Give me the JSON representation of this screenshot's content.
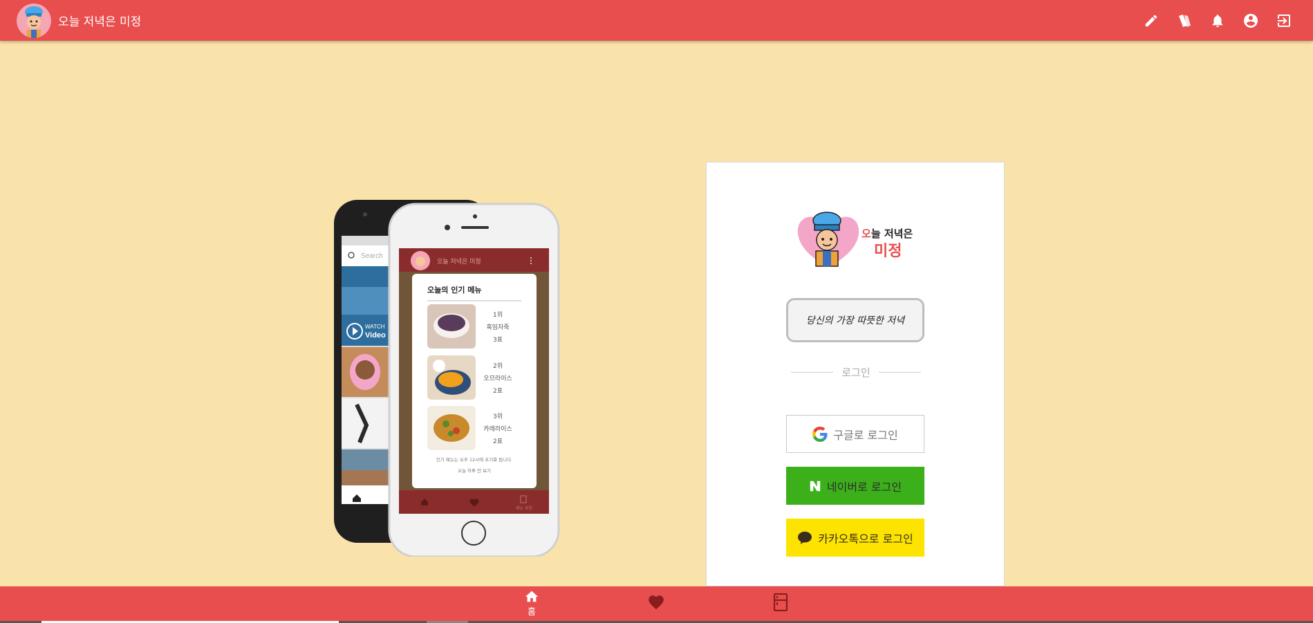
{
  "header": {
    "title": "오늘 저녁은 미정",
    "actions": [
      {
        "icon": "pencil-icon"
      },
      {
        "icon": "cards-icon"
      },
      {
        "icon": "bell-icon"
      },
      {
        "icon": "account-circle-icon"
      },
      {
        "icon": "logout-icon"
      }
    ]
  },
  "phone_mock": {
    "left_phone": {
      "search_placeholder": "Search",
      "video_caption_small": "WATCH",
      "video_caption": "Video"
    },
    "right_phone": {
      "app_title": "오늘 저녁은 미정",
      "popular_title": "오늘의 인기 메뉴",
      "items": [
        {
          "rank": "1위",
          "name": "흑임자죽",
          "votes": "3표"
        },
        {
          "rank": "2위",
          "name": "오므라이스",
          "votes": "2표"
        },
        {
          "rank": "3위",
          "name": "카레라이스",
          "votes": "2표"
        }
      ],
      "note1": "인기 메뉴는 오후 12시에 초기화 됩니다.",
      "note2": "오늘 하루 안 보기",
      "nav_last_label": "메뉴 추천"
    }
  },
  "login": {
    "brand_accent": "오",
    "brand_rest": "늘 저녁은",
    "brand_main": "미정",
    "slogan": "당신의 가장 따뜻한 저녁",
    "divider_label": "로그인",
    "google_label": "구글로 로그인",
    "naver_label": "네이버로 로그인",
    "kakao_label": "카카오톡으로 로그인"
  },
  "bottom_nav": {
    "home_label": "홈",
    "items": [
      {
        "icon": "home-icon"
      },
      {
        "icon": "heart-icon"
      },
      {
        "icon": "fridge-icon"
      }
    ]
  },
  "colors": {
    "primary": "#e94e4e",
    "background": "#f9e3aa",
    "naver": "#3cb01a",
    "kakao": "#fce300"
  }
}
